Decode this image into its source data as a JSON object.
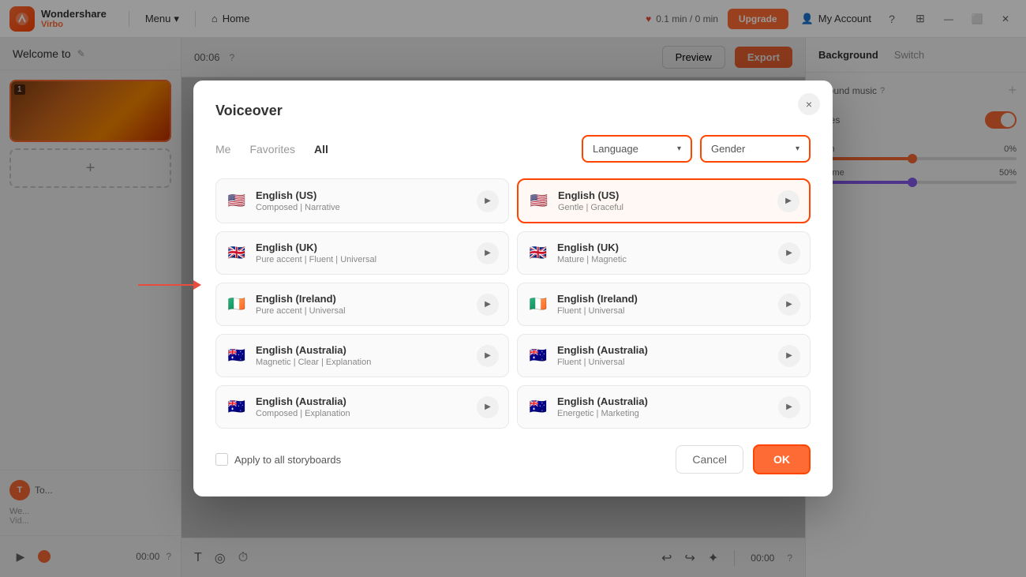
{
  "app": {
    "logo_line1": "Wondershare",
    "logo_line2": "Virbo",
    "menu_label": "Menu",
    "home_label": "Home",
    "time_display": "0.1 min / 0 min",
    "upgrade_label": "Upgrade",
    "account_label": "My Account"
  },
  "editor": {
    "welcome_label": "Welcome to",
    "time_code": "00:06",
    "timeline_time": "00:00",
    "preview_label": "Preview",
    "export_label": "Export",
    "background_label": "Background",
    "switch_label": "Switch"
  },
  "right_panel": {
    "tab1": "Background",
    "tab2": "Switch",
    "bg_music_label": "kground music",
    "subtitles_label": "btitles",
    "pitch_label": "Pitch",
    "pitch_value": "0%",
    "volume_label": "Volume",
    "volume_value": "50%"
  },
  "modal": {
    "title": "Voiceover",
    "close_icon": "×",
    "tab_me": "Me",
    "tab_favorites": "Favorites",
    "tab_all": "All",
    "language_placeholder": "Language",
    "gender_placeholder": "Gender",
    "voices": [
      {
        "id": "en-us-1",
        "name": "English (US)",
        "desc": "Composed | Narrative",
        "flag": "🇺🇸",
        "selected": false
      },
      {
        "id": "en-us-2",
        "name": "English (US)",
        "desc": "Gentle | Graceful",
        "flag": "🇺🇸",
        "selected": true
      },
      {
        "id": "en-uk-1",
        "name": "English (UK)",
        "desc": "Pure accent | Fluent | Universal",
        "flag": "🇬🇧",
        "selected": false
      },
      {
        "id": "en-uk-2",
        "name": "English (UK)",
        "desc": "Mature | Magnetic",
        "flag": "🇬🇧",
        "selected": false
      },
      {
        "id": "en-ie-1",
        "name": "English (Ireland)",
        "desc": "Pure accent | Universal",
        "flag": "🇮🇪",
        "selected": false
      },
      {
        "id": "en-ie-2",
        "name": "English (Ireland)",
        "desc": "Fluent | Universal",
        "flag": "🇮🇪",
        "selected": false
      },
      {
        "id": "en-au-1",
        "name": "English (Australia)",
        "desc": "Magnetic | Clear | Explanation",
        "flag": "🇦🇺",
        "selected": false
      },
      {
        "id": "en-au-2",
        "name": "English (Australia)",
        "desc": "Fluent | Universal",
        "flag": "🇦🇺",
        "selected": false
      },
      {
        "id": "en-au-3",
        "name": "English (Australia)",
        "desc": "Composed | Explanation",
        "flag": "🇦🇺",
        "selected": false
      },
      {
        "id": "en-au-4",
        "name": "English (Australia)",
        "desc": "Energetic | Marketing",
        "flag": "🇦🇺",
        "selected": false
      }
    ],
    "apply_label": "Apply to all storyboards",
    "cancel_label": "Cancel",
    "ok_label": "OK"
  }
}
